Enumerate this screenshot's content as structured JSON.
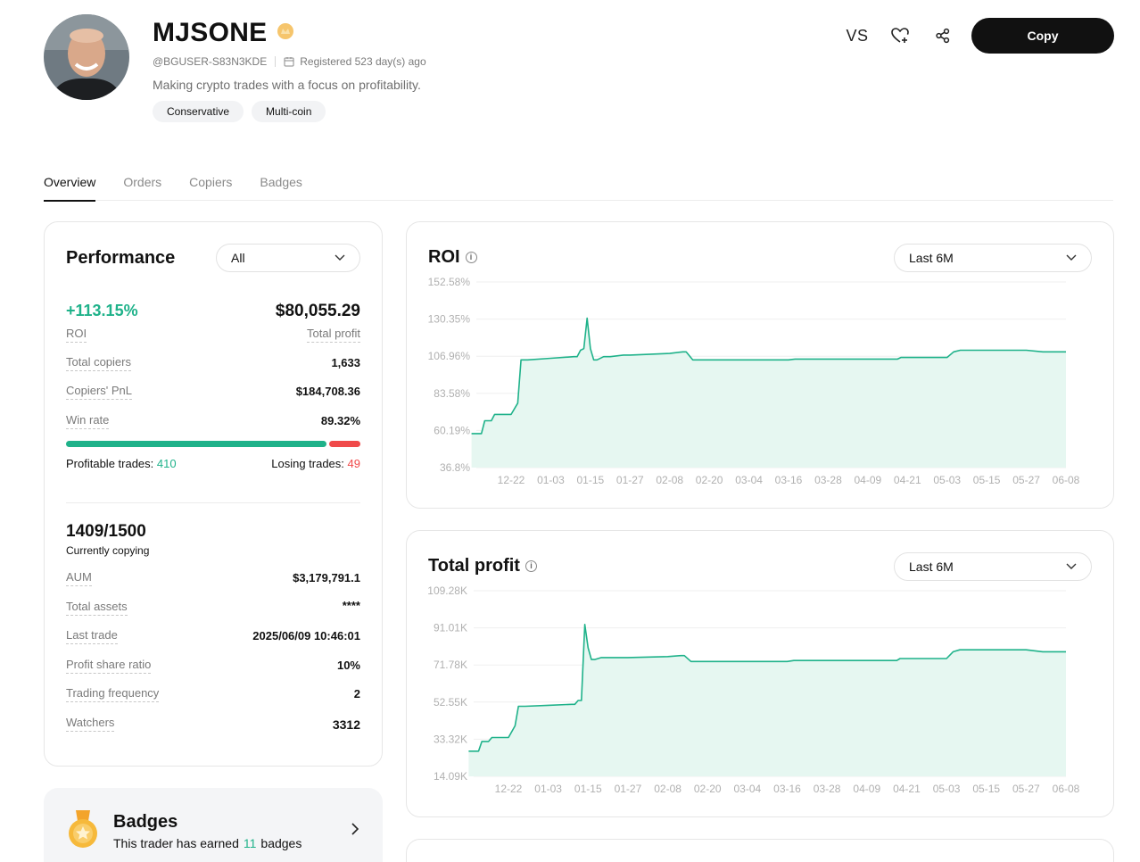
{
  "profile": {
    "name": "MJSONE",
    "user_id": "@BGUSER-S83N3KDE",
    "registered": "Registered 523 day(s) ago",
    "bio": "Making crypto trades with a focus on profitability.",
    "tags": [
      "Conservative",
      "Multi-coin"
    ]
  },
  "actions": {
    "vs_label": "VS",
    "copy_label": "Copy"
  },
  "tabs": [
    "Overview",
    "Orders",
    "Copiers",
    "Badges"
  ],
  "performance": {
    "title": "Performance",
    "filter": "All",
    "roi_value": "+113.15%",
    "roi_label": "ROI",
    "total_profit_value": "$80,055.29",
    "total_profit_label": "Total profit",
    "total_copiers_label": "Total copiers",
    "total_copiers_value": "1,633",
    "copiers_pnl_label": "Copiers' PnL",
    "copiers_pnl_value": "$184,708.36",
    "win_rate_label": "Win rate",
    "win_rate_value": "89.32%",
    "win_rate_fraction": 0.8932,
    "profitable_label": "Profitable trades:",
    "profitable_value": "410",
    "losing_label": "Losing trades:",
    "losing_value": "49",
    "copying_value": "1409/1500",
    "copying_label": "Currently copying",
    "aum_label": "AUM",
    "aum_value": "$3,179,791.1",
    "total_assets_label": "Total assets",
    "total_assets_value": "****",
    "last_trade_label": "Last trade",
    "last_trade_value": "2025/06/09 10:46:01",
    "profit_share_label": "Profit share ratio",
    "profit_share_value": "10%",
    "trading_freq_label": "Trading frequency",
    "trading_freq_value": "2",
    "watchers_label": "Watchers",
    "watchers_value": "3312"
  },
  "badges": {
    "title": "Badges",
    "sub_prefix": "This trader has earned",
    "count": "11",
    "sub_suffix": "badges"
  },
  "colors": {
    "accent": "#1fb28a",
    "loss": "#f04a4a",
    "button": "#111111"
  },
  "chart_data": [
    {
      "type": "area",
      "title": "ROI",
      "range_filter": "Last 6M",
      "y_ticks": [
        "152.58%",
        "130.35%",
        "106.96%",
        "83.58%",
        "60.19%",
        "36.8%"
      ],
      "x_ticks": [
        "12-22",
        "01-03",
        "01-15",
        "01-27",
        "02-08",
        "02-20",
        "03-04",
        "03-16",
        "03-28",
        "04-09",
        "04-21",
        "05-03",
        "05-15",
        "05-27",
        "06-08"
      ],
      "ylim": [
        36.8,
        152.58
      ],
      "series": [
        {
          "x": [
            "12-10",
            "12-13",
            "12-14",
            "12-16",
            "12-17",
            "12-22",
            "12-24",
            "12-25",
            "12-27",
            "01-03",
            "01-10",
            "01-11",
            "01-12",
            "01-13",
            "01-14",
            "01-15",
            "01-16",
            "01-17",
            "01-19",
            "01-21",
            "01-25",
            "01-27",
            "02-08",
            "02-12",
            "02-13",
            "02-15",
            "02-20",
            "03-04",
            "03-16",
            "03-18",
            "03-28",
            "04-09",
            "04-18",
            "04-19",
            "04-21",
            "05-03",
            "05-05",
            "05-07",
            "05-15",
            "05-27",
            "06-01",
            "06-08"
          ],
          "values": [
            58,
            58,
            66,
            66,
            70,
            70,
            77,
            104,
            104,
            105,
            106,
            106,
            110,
            111,
            130,
            111,
            104,
            104,
            106,
            106,
            107,
            107,
            108,
            109,
            109,
            104,
            104,
            104,
            104,
            104.5,
            104.5,
            104.5,
            104.5,
            105.5,
            105.5,
            105.5,
            109,
            110,
            110,
            110,
            109,
            109
          ]
        }
      ]
    },
    {
      "type": "area",
      "title": "Total profit",
      "range_filter": "Last 6M",
      "y_ticks": [
        "109.28K",
        "91.01K",
        "71.78K",
        "52.55K",
        "33.32K",
        "14.09K"
      ],
      "x_ticks": [
        "12-22",
        "01-03",
        "01-15",
        "01-27",
        "02-08",
        "02-20",
        "03-04",
        "03-16",
        "03-28",
        "04-09",
        "04-21",
        "05-03",
        "05-15",
        "05-27",
        "06-08"
      ],
      "ylim": [
        14.09,
        109.28
      ],
      "series": [
        {
          "x": [
            "12-10",
            "12-13",
            "12-14",
            "12-16",
            "12-17",
            "12-22",
            "12-24",
            "12-25",
            "12-27",
            "01-03",
            "01-10",
            "01-11",
            "01-12",
            "01-13",
            "01-14",
            "01-15",
            "01-16",
            "01-17",
            "01-19",
            "01-21",
            "01-25",
            "01-27",
            "02-08",
            "02-12",
            "02-13",
            "02-15",
            "02-20",
            "03-04",
            "03-16",
            "03-18",
            "03-28",
            "04-09",
            "04-18",
            "04-19",
            "04-21",
            "05-03",
            "05-05",
            "05-07",
            "05-15",
            "05-27",
            "06-01",
            "06-08"
          ],
          "values": [
            27,
            27,
            32,
            32,
            34,
            34,
            40,
            50,
            50,
            50.5,
            51,
            51,
            53,
            53,
            92,
            80,
            74,
            74,
            75,
            75,
            75,
            75,
            75.5,
            76,
            76,
            73,
            73,
            73,
            73,
            73.5,
            73.5,
            73.5,
            73.5,
            74.5,
            74.5,
            74.5,
            78,
            79,
            79,
            79,
            78,
            78
          ]
        }
      ]
    }
  ]
}
